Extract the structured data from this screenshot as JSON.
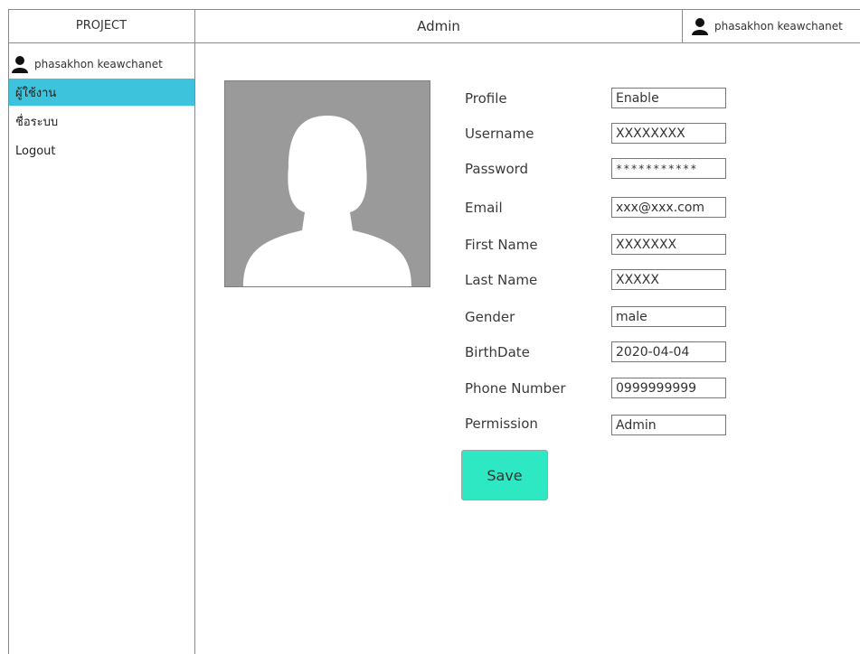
{
  "header": {
    "project_label": "PROJECT",
    "title": "Admin",
    "user_name": "phasakhon keawchanet",
    "user_icon": "person-icon"
  },
  "sidebar": {
    "user_name": "phasakhon keawchanet",
    "user_icon": "person-icon",
    "items": [
      {
        "label": "ผู้ใช้งาน",
        "active": true
      },
      {
        "label": "ชื่อระบบ",
        "active": false
      },
      {
        "label": "Logout",
        "active": false
      }
    ]
  },
  "profile": {
    "avatar_icon": "user-silhouette-icon"
  },
  "form": {
    "fields": [
      {
        "label": "Profile",
        "value": "Enable"
      },
      {
        "label": "Username",
        "value": "XXXXXXXX"
      },
      {
        "label": "Password",
        "value": "***********"
      },
      {
        "label": "Email",
        "value": "xxx@xxx.com"
      },
      {
        "label": "First Name",
        "value": "XXXXXXX"
      },
      {
        "label": "Last Name",
        "value": "XXXXX"
      },
      {
        "label": "Gender",
        "value": "male"
      },
      {
        "label": "BirthDate",
        "value": "2020-04-04"
      },
      {
        "label": "Phone Number",
        "value": "0999999999"
      },
      {
        "label": "Permission",
        "value": "Admin"
      }
    ],
    "save_label": "Save"
  },
  "colors": {
    "active_nav": "#3ec3dc",
    "save_button": "#2de8c2",
    "avatar_bg": "#9a9a9a"
  }
}
